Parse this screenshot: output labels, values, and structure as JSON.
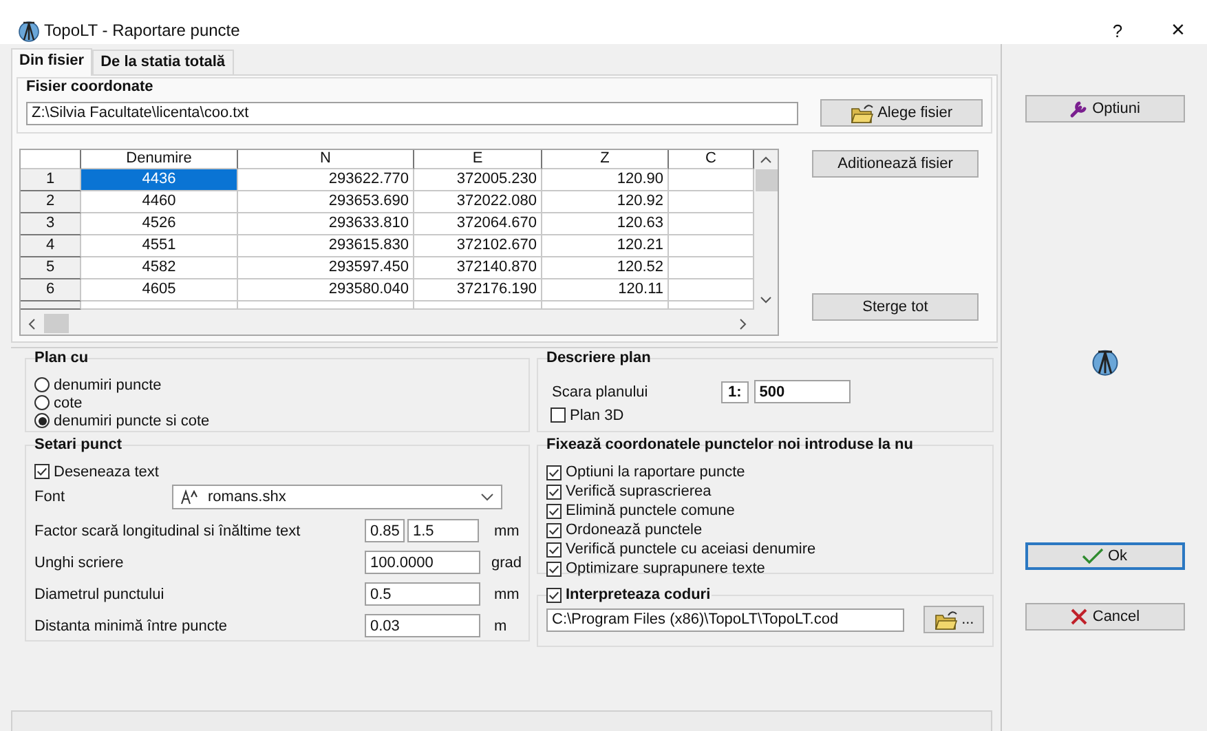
{
  "window": {
    "title": "TopoLT - Raportare puncte",
    "help": "?",
    "close": "×"
  },
  "tabs": [
    {
      "label": "Din fisier",
      "selected": true
    },
    {
      "label": "De la statia totală",
      "selected": false
    }
  ],
  "file_group": {
    "title": "Fisier coordonate",
    "path": "Z:\\Silvia Facultate\\licenta\\coo.txt",
    "browse_button": "Alege fisier"
  },
  "table": {
    "columns": [
      "Denumire",
      "N",
      "E",
      "Z",
      "C"
    ],
    "rows": [
      {
        "number": "1",
        "cells": [
          "4436",
          "293622.770",
          "372005.230",
          "120.90"
        ],
        "selected": true
      },
      {
        "number": "2",
        "cells": [
          "4460",
          "293653.690",
          "372022.080",
          "120.92"
        ],
        "selected": false
      },
      {
        "number": "3",
        "cells": [
          "4526",
          "293633.810",
          "372064.670",
          "120.63"
        ],
        "selected": false
      },
      {
        "number": "4",
        "cells": [
          "4551",
          "293615.830",
          "372102.670",
          "120.21"
        ],
        "selected": false
      },
      {
        "number": "5",
        "cells": [
          "4582",
          "293597.450",
          "372140.870",
          "120.52"
        ],
        "selected": false
      },
      {
        "number": "6",
        "cells": [
          "4605",
          "293580.040",
          "372176.190",
          "120.11"
        ],
        "selected": false
      }
    ]
  },
  "table_buttons": [
    "Aditionează fisier",
    "Sterge tot"
  ],
  "plan_cu": {
    "title": "Plan cu",
    "options": [
      {
        "label": "denumiri puncte",
        "selected": false
      },
      {
        "label": "cote",
        "selected": false
      },
      {
        "label": "denumiri puncte si cote",
        "selected": true
      }
    ]
  },
  "descriere_plan": {
    "title": "Descriere plan",
    "scale_label": "Scara planului",
    "scale_prefix": "1:",
    "scale_value": "500",
    "plan_3d": {
      "label": "Plan 3D",
      "checked": false
    }
  },
  "setari_punct": {
    "title": "Setari punct",
    "draw_text": {
      "label": "Deseneaza text",
      "checked": true
    },
    "font": {
      "label": "Font",
      "value": "romans.shx"
    },
    "fields": [
      {
        "label": "Factor scară longitudinal si înăltime text",
        "values": [
          "0.85",
          "1.5"
        ],
        "unit": "mm"
      },
      {
        "label": "Unghi scriere",
        "values": [
          "100.0000"
        ],
        "unit": "grad"
      },
      {
        "label": "Diametrul punctului",
        "values": [
          "0.5"
        ],
        "unit": "mm"
      },
      {
        "label": "Distanta minimă între puncte",
        "values": [
          "0.03"
        ],
        "unit": "m"
      }
    ]
  },
  "fixeaza": {
    "title": "Fixează coordonatele punctelor noi introduse la nu",
    "options": [
      {
        "label": "Optiuni la raportare puncte",
        "checked": true
      },
      {
        "label": "Verifică suprascrierea",
        "checked": true
      },
      {
        "label": "Elimină punctele comune",
        "checked": true
      },
      {
        "label": "Ordonează punctele",
        "checked": true
      },
      {
        "label": "Verifică punctele cu aceiasi denumire",
        "checked": true
      },
      {
        "label": "Optimizare suprapunere texte",
        "checked": true
      }
    ]
  },
  "coduri": {
    "label": "Interpreteaza coduri",
    "checked": true,
    "path": "C:\\Program Files (x86)\\TopoLT\\TopoLT.cod",
    "button": "..."
  },
  "side": {
    "options_button": "Optiuni",
    "ok_button": "Ok",
    "cancel_button": "Cancel"
  }
}
